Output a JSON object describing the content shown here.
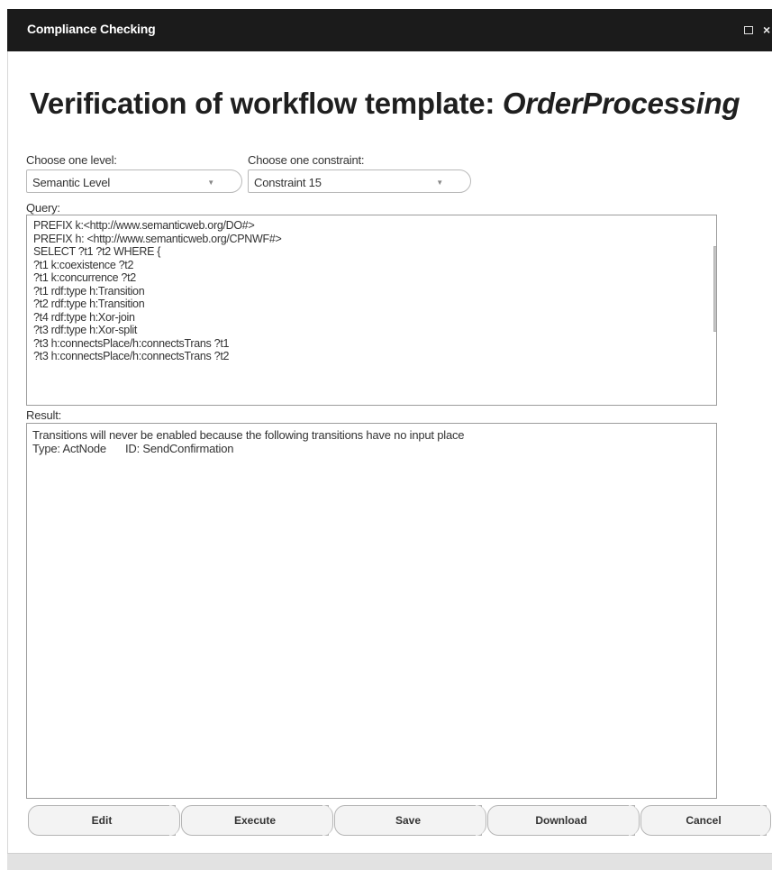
{
  "window": {
    "title": "Compliance Checking",
    "maximize_glyph": "□",
    "close_glyph": "×"
  },
  "heading": {
    "prefix": "Verification of workflow template: ",
    "workflow_name": "OrderProcessing"
  },
  "level": {
    "label": "Choose one level:",
    "selected": "Semantic Level"
  },
  "constraint": {
    "label": "Choose one constraint:",
    "selected": "Constraint 15"
  },
  "query": {
    "label": "Query:",
    "lines": [
      "PREFIX k:<http://www.semanticweb.org/DO#>",
      "PREFIX h: <http://www.semanticweb.org/CPNWF#>",
      "SELECT ?t1 ?t2 WHERE {",
      "?t1 k:coexistence ?t2",
      "?t1 k:concurrence ?t2",
      "?t1 rdf:type h:Transition",
      "?t2 rdf:type h:Transition",
      "?t4 rdf:type h:Xor-join",
      "?t3 rdf:type h:Xor-split",
      "?t3 h:connectsPlace/h:connectsTrans ?t1",
      "?t3 h:connectsPlace/h:connectsTrans ?t2"
    ]
  },
  "result": {
    "label": "Result:",
    "message": "Transitions will never be enabled because the following transitions have no input place",
    "type_label": "Type: ActNode",
    "id_label": "ID: SendConfirmation"
  },
  "buttons": {
    "edit": "Edit",
    "execute": "Execute",
    "save": "Save",
    "download": "Download",
    "cancel": "Cancel"
  }
}
